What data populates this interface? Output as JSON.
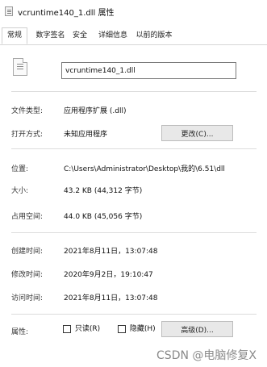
{
  "window": {
    "title": "vcruntime140_1.dll 属性"
  },
  "tabs": [
    {
      "label": "常规"
    },
    {
      "label": "数字签名"
    },
    {
      "label": "安全"
    },
    {
      "label": "详细信息"
    },
    {
      "label": "以前的版本"
    }
  ],
  "general": {
    "file_name": "vcruntime140_1.dll",
    "properties": [
      {
        "label": "文件类型:",
        "value": "应用程序扩展 (.dll)"
      },
      {
        "label": "打开方式:",
        "value": "未知应用程序"
      },
      {
        "label": "位置:",
        "value": "C:\\Users\\Administrator\\Desktop\\我的\\6.51\\dll"
      },
      {
        "label": "大小:",
        "value": "43.2 KB (44,312 字节)"
      },
      {
        "label": "占用空间:",
        "value": "44.0 KB (45,056 字节)"
      },
      {
        "label": "创建时间:",
        "value": "2021年8月11日，13:07:48"
      },
      {
        "label": "修改时间:",
        "value": "2020年9月2日，19:10:47"
      },
      {
        "label": "访问时间:",
        "value": "2021年8月11日，13:07:48"
      }
    ],
    "attributes_label": "属性:",
    "readonly_label": "只读(R)",
    "hidden_label": "隐藏(H)",
    "change_button": "更改(C)...",
    "advanced_button": "高级(D)..."
  },
  "watermark": {
    "footer": "CSDN @电脑修复X"
  }
}
